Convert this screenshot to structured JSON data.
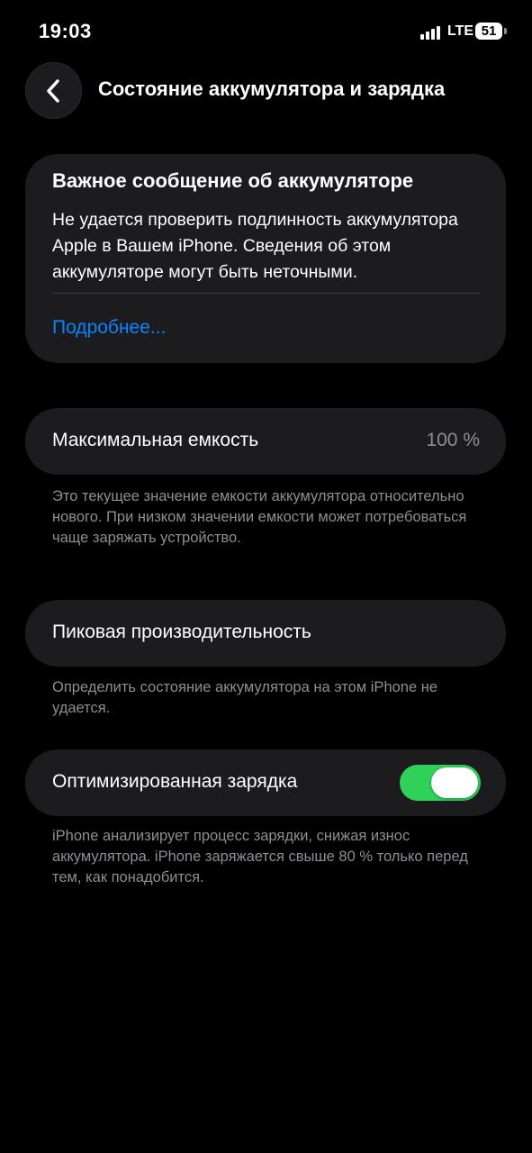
{
  "status_bar": {
    "time": "19:03",
    "network": "LTE",
    "battery": "51",
    "icons": [
      "signal-bars-icon",
      "battery-icon"
    ]
  },
  "header": {
    "back_icon": "chevron-left-icon",
    "title": "Состояние аккумулятора и зарядка"
  },
  "alert": {
    "title": "Важное сообщение об аккумуляторе",
    "text": "Не удается проверить подлинность аккумулятора Apple в Вашем iPhone. Сведения об этом аккумуляторе могут быть неточными.",
    "link": "Подробнее..."
  },
  "capacity": {
    "label": "Максимальная емкость",
    "value": "100 %",
    "note": "Это текущее значение емкости аккумулятора относительно нового. При низком значении емкости может потребоваться чаще заряжать устройство."
  },
  "peak": {
    "label": "Пиковая производительность",
    "note": "Определить состояние аккумулятора на этом iPhone не удается."
  },
  "charging": {
    "label": "Оптимизированная зарядка",
    "enabled": true,
    "note": "iPhone анализирует процесс зарядки, снижая износ аккумулятора. iPhone заряжается свыше 80 % только перед тем, как понадобится."
  },
  "colors": {
    "background": "#000000",
    "card": "#1c1c1e",
    "link": "#0a84ff",
    "toggle_on": "#30d158",
    "secondary_text": "#8e8e93"
  }
}
